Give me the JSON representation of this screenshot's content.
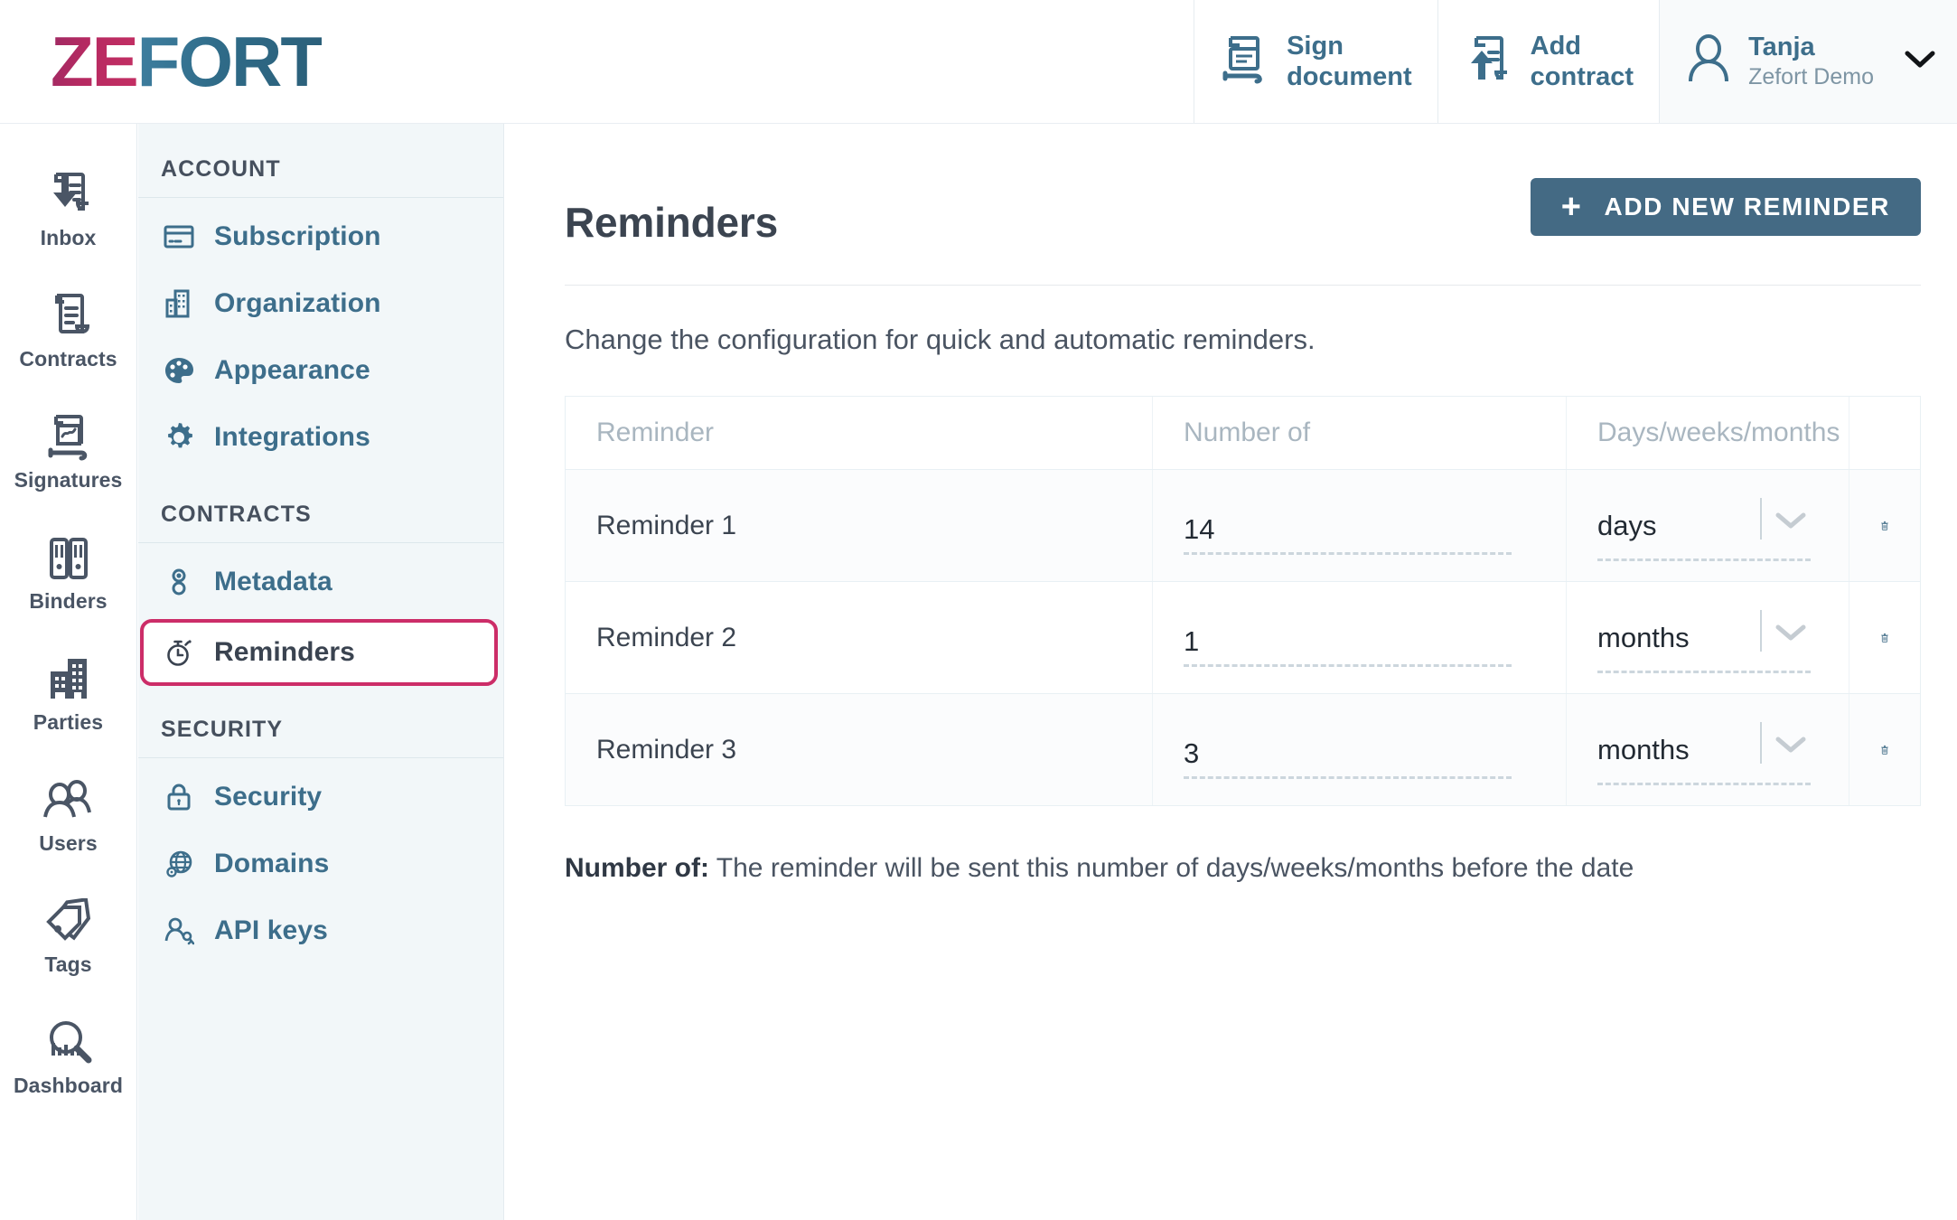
{
  "brand": {
    "logo_part1": "ZE",
    "logo_part2": "FORT",
    "accent_blue": "#3d6e8b",
    "accent_pink": "#cc2d68",
    "button_blue": "#446a84"
  },
  "header": {
    "actions": [
      {
        "label": "Sign\ndocument",
        "icon": "sign-document-icon"
      },
      {
        "label": "Add\ncontract",
        "icon": "add-contract-icon"
      }
    ],
    "user": {
      "name": "Tanja",
      "org": "Zefort Demo",
      "avatar_icon": "user-avatar-icon",
      "chevron_icon": "chevron-down-icon"
    }
  },
  "rail": {
    "items": [
      {
        "label": "Inbox",
        "icon": "inbox-icon"
      },
      {
        "label": "Contracts",
        "icon": "contract-document-icon"
      },
      {
        "label": "Signatures",
        "icon": "signature-icon"
      },
      {
        "label": "Binders",
        "icon": "binders-icon"
      },
      {
        "label": "Parties",
        "icon": "buildings-icon"
      },
      {
        "label": "Users",
        "icon": "users-icon"
      },
      {
        "label": "Tags",
        "icon": "tags-icon"
      },
      {
        "label": "Dashboard",
        "icon": "dashboard-search-icon"
      }
    ]
  },
  "settings_nav": {
    "groups": [
      {
        "title": "ACCOUNT",
        "items": [
          {
            "label": "Subscription",
            "icon": "credit-card-icon",
            "active": false
          },
          {
            "label": "Organization",
            "icon": "building-icon",
            "active": false
          },
          {
            "label": "Appearance",
            "icon": "palette-icon",
            "active": false
          },
          {
            "label": "Integrations",
            "icon": "gear-icon",
            "active": false
          }
        ]
      },
      {
        "title": "CONTRACTS",
        "items": [
          {
            "label": "Metadata",
            "icon": "metadata-icon",
            "active": false
          },
          {
            "label": "Reminders",
            "icon": "stopwatch-icon",
            "active": true
          }
        ]
      },
      {
        "title": "SECURITY",
        "items": [
          {
            "label": "Security",
            "icon": "lock-icon",
            "active": false
          },
          {
            "label": "Domains",
            "icon": "globe-gear-icon",
            "active": false
          },
          {
            "label": "API keys",
            "icon": "api-key-user-icon",
            "active": false
          }
        ]
      }
    ]
  },
  "main": {
    "title": "Reminders",
    "add_button": {
      "label": "ADD NEW REMINDER",
      "icon": "plus-icon"
    },
    "subtitle": "Change the configuration for quick and automatic reminders.",
    "table": {
      "columns": [
        "Reminder",
        "Number of",
        "Days/weeks/months",
        "•••"
      ],
      "rows": [
        {
          "name": "Reminder 1",
          "number": "14",
          "unit": "days",
          "delete_icon": "trash-icon"
        },
        {
          "name": "Reminder 2",
          "number": "1",
          "unit": "months",
          "delete_icon": "trash-icon"
        },
        {
          "name": "Reminder 3",
          "number": "3",
          "unit": "months",
          "delete_icon": "trash-icon"
        }
      ]
    },
    "footnote_label": "Number of:",
    "footnote_text": " The reminder will be sent this number of days/weeks/months before the date"
  }
}
